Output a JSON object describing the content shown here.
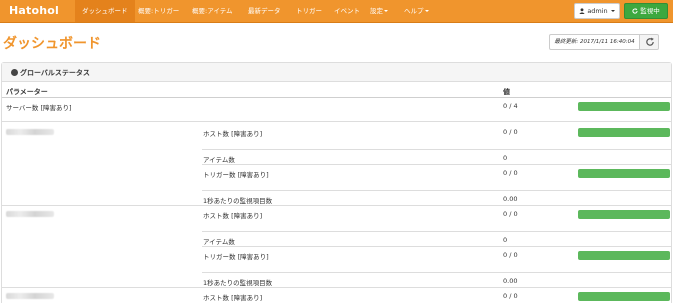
{
  "navbar": {
    "brand": "Hatohol",
    "items": [
      {
        "label": "ダッシュボード"
      },
      {
        "label": "概要:トリガー"
      },
      {
        "label": "概要:アイテム"
      },
      {
        "label": "最新データ"
      },
      {
        "label": "トリガー"
      },
      {
        "label": "イベント"
      },
      {
        "label": "設定"
      },
      {
        "label": "ヘルプ"
      }
    ],
    "user_label": "admin",
    "monitor_label": "監視中"
  },
  "page": {
    "title": "ダッシュボード",
    "last_updated": "最終更新: 2017/1/11 16:40:04"
  },
  "panel": {
    "title": "グローバルステータス",
    "headers": {
      "parameter": "パラメーター",
      "value": "値"
    },
    "summary": {
      "label": "サーバー数 [障害あり]",
      "value": "0 / 4"
    },
    "servers": [
      {
        "rows": [
          {
            "label": "ホスト数 [障害あり]",
            "value": "0 / 0"
          },
          {
            "label": "アイテム数",
            "value": "0"
          },
          {
            "label": "トリガー数 [障害あり]",
            "value": "0 / 0"
          },
          {
            "label": "1秒あたりの監視項目数",
            "value": "0.00"
          }
        ]
      },
      {
        "rows": [
          {
            "label": "ホスト数 [障害あり]",
            "value": "0 / 0"
          },
          {
            "label": "アイテム数",
            "value": "0"
          },
          {
            "label": "トリガー数 [障害あり]",
            "value": "0 / 0"
          },
          {
            "label": "1秒あたりの監視項目数",
            "value": "0.00"
          }
        ]
      },
      {
        "rows": [
          {
            "label": "ホスト数 [障害あり]",
            "value": "0 / 0"
          }
        ]
      }
    ]
  },
  "colors": {
    "brand": "#f0952d",
    "ok": "#5cb85c",
    "monitor": "#3da83f"
  }
}
